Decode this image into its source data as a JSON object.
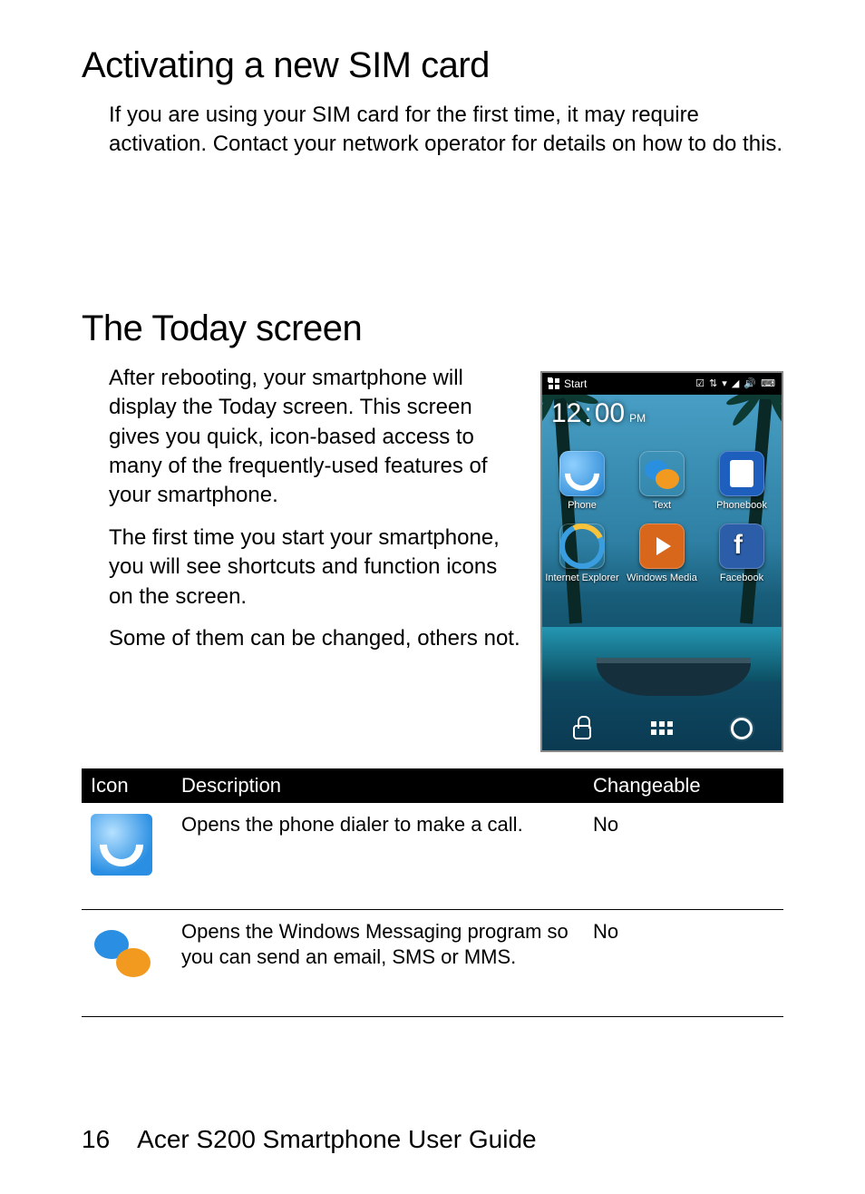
{
  "section1": {
    "heading": "Activating a new SIM card",
    "para": "If you are using your SIM card for the first time, it may require activation. Contact your network operator for details on how to do this."
  },
  "section2": {
    "heading": "The Today screen",
    "para1": "After rebooting, your smartphone will display the Today screen. This screen gives you quick, icon-based access to many of the frequently-used features of your smartphone.",
    "para2": "The first time you start your smartphone, you will see shortcuts and function icons on the screen.",
    "para3": "Some of them can be changed, others not."
  },
  "phone": {
    "start_label": "Start",
    "status_glyphs": "☑ ⇅ ▾ ◢ 🔊 ⌨",
    "clock_h": "12",
    "clock_sep": ":",
    "clock_m": "00",
    "clock_ampm": "PM",
    "apps": [
      {
        "label": "Phone"
      },
      {
        "label": "Text"
      },
      {
        "label": "Phonebook"
      },
      {
        "label": "Internet Explorer"
      },
      {
        "label": "Windows Media"
      },
      {
        "label": "Facebook"
      }
    ]
  },
  "table": {
    "headers": {
      "icon": "Icon",
      "desc": "Description",
      "chg": "Changeable"
    },
    "rows": [
      {
        "icon_name": "phone-dialer-icon",
        "desc": "Opens the phone dialer to make a call.",
        "chg": "No"
      },
      {
        "icon_name": "messaging-icon",
        "desc": "Opens the Windows Messaging program so you can send an email, SMS or MMS.",
        "chg": "No"
      }
    ]
  },
  "footer": {
    "page": "16",
    "title": "Acer S200 Smartphone User Guide"
  }
}
